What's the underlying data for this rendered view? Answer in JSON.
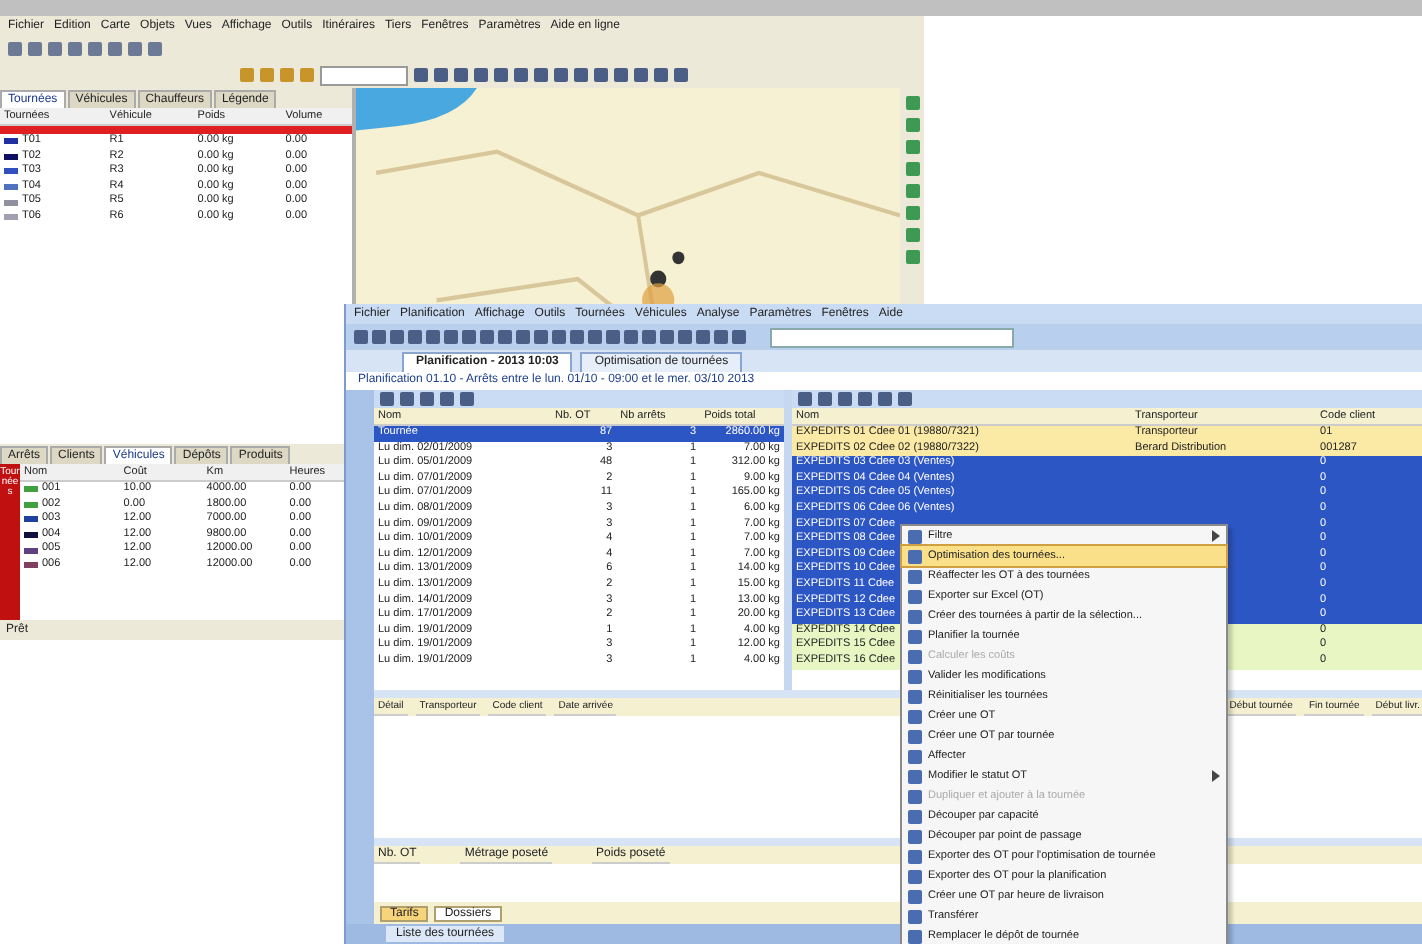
{
  "back_window": {
    "menu": [
      "Fichier",
      "Edition",
      "Carte",
      "Objets",
      "Vues",
      "Affichage",
      "Outils",
      "Itinéraires",
      "Tiers",
      "Fenêtres",
      "Paramètres",
      "Aide en ligne"
    ],
    "left_tabs": [
      {
        "label": "Tournées",
        "selected": true
      },
      {
        "label": "Véhicules",
        "selected": false
      },
      {
        "label": "Chauffeurs",
        "selected": false
      },
      {
        "label": "Légende",
        "selected": false
      }
    ],
    "routes_table": {
      "columns": [
        "Tournées",
        "Véhicule",
        "Poids",
        "Volume"
      ],
      "rows": [
        {
          "cells": [
            "T01",
            "R1",
            "0.00 kg",
            "0.00"
          ],
          "color": "#2030a0"
        },
        {
          "cells": [
            "T02",
            "R2",
            "0.00 kg",
            "0.00"
          ],
          "color": "#101060"
        },
        {
          "cells": [
            "T03",
            "R3",
            "0.00 kg",
            "0.00"
          ],
          "color": "#3050c0"
        },
        {
          "cells": [
            "T04",
            "R4",
            "0.00 kg",
            "0.00"
          ],
          "color": "#5070c0"
        },
        {
          "cells": [
            "T05",
            "R5",
            "0.00 kg",
            "0.00"
          ],
          "color": "#9090a0"
        },
        {
          "cells": [
            "T06",
            "R6",
            "0.00 kg",
            "0.00"
          ],
          "color": "#a0a0b0"
        }
      ]
    },
    "bottom_tabs": [
      {
        "label": "Arrêts",
        "selected": false
      },
      {
        "label": "Clients",
        "selected": false
      },
      {
        "label": "Véhicules",
        "selected": true
      },
      {
        "label": "Dépôts",
        "selected": false
      },
      {
        "label": "Produits",
        "selected": false
      }
    ],
    "side_label": "Tournées",
    "bottom_table": {
      "columns": [
        "Nom",
        "Coût",
        "Km",
        "Heures"
      ],
      "rows": [
        {
          "cells": [
            "001",
            "10.00",
            "4000.00",
            "0.00"
          ],
          "color": "#40a040"
        },
        {
          "cells": [
            "002",
            "0.00",
            "1800.00",
            "0.00"
          ],
          "color": "#40a040"
        },
        {
          "cells": [
            "003",
            "12.00",
            "7000.00",
            "0.00"
          ],
          "color": "#2040a0"
        },
        {
          "cells": [
            "004",
            "12.00",
            "9800.00",
            "0.00"
          ],
          "color": "#101040"
        },
        {
          "cells": [
            "005",
            "12.00",
            "12000.00",
            "0.00"
          ],
          "color": "#604080"
        },
        {
          "cells": [
            "006",
            "12.00",
            "12000.00",
            "0.00"
          ],
          "color": "#804060"
        }
      ]
    },
    "status": "Prêt"
  },
  "front_window": {
    "menu": [
      "Fichier",
      "Planification",
      "Affichage",
      "Outils",
      "Tournées",
      "Véhicules",
      "Analyse",
      "Paramètres",
      "Fenêtres",
      "Aide"
    ],
    "doc_tabs": [
      {
        "label": "Planification - 2013 10:03",
        "selected": true
      },
      {
        "label": "Optimisation de tournées",
        "selected": false
      }
    ],
    "info_line": "Planification 01.10 - Arrêts entre le lun. 01/10 - 09:00 et le mer. 03/10 2013",
    "tours_table": {
      "columns": [
        "Nom",
        "Nb. OT",
        "Nb arrêts",
        "Poids total"
      ],
      "rows": [
        {
          "cells": [
            "Tournée",
            "87",
            "3",
            "2860.00 kg"
          ],
          "selected": true
        },
        {
          "cells": [
            "Lu dim. 02/01/2009",
            "3",
            "1",
            "7.00 kg"
          ],
          "selected": false
        },
        {
          "cells": [
            "Lu dim. 05/01/2009",
            "48",
            "1",
            "312.00 kg"
          ],
          "selected": false
        },
        {
          "cells": [
            "Lu dim. 07/01/2009",
            "2",
            "1",
            "9.00 kg"
          ],
          "selected": false
        },
        {
          "cells": [
            "Lu dim. 07/01/2009",
            "11",
            "1",
            "165.00 kg"
          ],
          "selected": false
        },
        {
          "cells": [
            "Lu dim. 08/01/2009",
            "3",
            "1",
            "6.00 kg"
          ],
          "selected": false
        },
        {
          "cells": [
            "Lu dim. 09/01/2009",
            "3",
            "1",
            "7.00 kg"
          ],
          "selected": false
        },
        {
          "cells": [
            "Lu dim. 10/01/2009",
            "4",
            "1",
            "7.00 kg"
          ],
          "selected": false
        },
        {
          "cells": [
            "Lu dim. 12/01/2009",
            "4",
            "1",
            "7.00 kg"
          ],
          "selected": false
        },
        {
          "cells": [
            "Lu dim. 13/01/2009",
            "6",
            "1",
            "14.00 kg"
          ],
          "selected": false
        },
        {
          "cells": [
            "Lu dim. 13/01/2009",
            "2",
            "1",
            "15.00 kg"
          ],
          "selected": false
        },
        {
          "cells": [
            "Lu dim. 14/01/2009",
            "3",
            "1",
            "13.00 kg"
          ],
          "selected": false
        },
        {
          "cells": [
            "Lu dim. 17/01/2009",
            "2",
            "1",
            "20.00 kg"
          ],
          "selected": false
        },
        {
          "cells": [
            "Lu dim. 19/01/2009",
            "1",
            "1",
            "4.00 kg"
          ],
          "selected": false
        },
        {
          "cells": [
            "Lu dim. 19/01/2009",
            "3",
            "1",
            "12.00 kg"
          ],
          "selected": false
        },
        {
          "cells": [
            "Lu dim. 19/01/2009",
            "3",
            "1",
            "4.00 kg"
          ],
          "selected": false
        }
      ]
    },
    "orders_table": {
      "columns": [
        "Nom",
        "Transporteur",
        "Code client"
      ],
      "rows": [
        {
          "kind": "group",
          "cells": [
            "EXPEDITS 01 Cdee 01 (19880/7321)",
            "Transporteur",
            "01"
          ],
          "selected": false
        },
        {
          "kind": "group",
          "cells": [
            "EXPEDITS 02 Cdee 02 (19880/7322)",
            "Berard Distribution",
            "001287"
          ],
          "selected": false
        },
        {
          "kind": "item",
          "cells": [
            "EXPEDITS 03 Cdee 03 (Ventes)",
            "",
            "0"
          ],
          "selected": true
        },
        {
          "kind": "item",
          "cells": [
            "EXPEDITS 04 Cdee 04 (Ventes)",
            "",
            "0"
          ],
          "selected": true
        },
        {
          "kind": "item",
          "cells": [
            "EXPEDITS 05 Cdee 05 (Ventes)",
            "",
            "0"
          ],
          "selected": true
        },
        {
          "kind": "item",
          "cells": [
            "EXPEDITS 06 Cdee 06 (Ventes)",
            "",
            "0"
          ],
          "selected": true
        },
        {
          "kind": "item",
          "cells": [
            "EXPEDITS 07 Cdee",
            "",
            "0"
          ],
          "selected": true
        },
        {
          "kind": "item",
          "cells": [
            "EXPEDITS 08 Cdee",
            "",
            "0"
          ],
          "selected": true
        },
        {
          "kind": "item",
          "cells": [
            "EXPEDITS 09 Cdee",
            "",
            "0"
          ],
          "selected": true
        },
        {
          "kind": "item",
          "cells": [
            "EXPEDITS 10 Cdee",
            "",
            "0"
          ],
          "selected": true
        },
        {
          "kind": "item",
          "cells": [
            "EXPEDITS 11 Cdee",
            "",
            "0"
          ],
          "selected": true
        },
        {
          "kind": "item",
          "cells": [
            "EXPEDITS 12 Cdee",
            "",
            "0"
          ],
          "selected": true
        },
        {
          "kind": "item",
          "cells": [
            "EXPEDITS 13 Cdee",
            "",
            "0"
          ],
          "selected": true
        },
        {
          "kind": "item",
          "cells": [
            "EXPEDITS 14 Cdee",
            "",
            "0"
          ],
          "selected": false
        },
        {
          "kind": "item",
          "cells": [
            "EXPEDITS 15 Cdee",
            "",
            "0"
          ],
          "selected": false
        },
        {
          "kind": "item",
          "cells": [
            "EXPEDITS 16 Cdee",
            "",
            "0"
          ],
          "selected": false
        }
      ]
    },
    "detail_columns": [
      "Détail",
      "Transporteur",
      "Code client",
      "Date arrivée",
      "Début tournée",
      "Fin tournée",
      "Début livr."
    ],
    "summary_columns": [
      "Nb. OT",
      "Métrage poseté",
      "Poids poseté"
    ],
    "bottom_tabs": [
      {
        "label": "Tarifs",
        "selected": true
      },
      {
        "label": "Dossiers",
        "selected": false
      }
    ],
    "footer_tab": "Liste des tournées"
  },
  "context_menu": [
    {
      "label": "Filtre",
      "selected": false,
      "disabled": false,
      "submenu": true
    },
    {
      "label": "Optimisation des tournées...",
      "selected": true,
      "disabled": false,
      "submenu": false
    },
    {
      "label": "Réaffecter les OT à des tournées",
      "selected": false,
      "disabled": false,
      "submenu": false
    },
    {
      "label": "Exporter sur Excel (OT)",
      "selected": false,
      "disabled": false,
      "submenu": false
    },
    {
      "label": "Créer des tournées à partir de la sélection...",
      "selected": false,
      "disabled": false,
      "submenu": false
    },
    {
      "label": "Planifier la tournée",
      "selected": false,
      "disabled": false,
      "submenu": false
    },
    {
      "label": "Calculer les coûts",
      "selected": false,
      "disabled": true,
      "submenu": false
    },
    {
      "label": "Valider les modifications",
      "selected": false,
      "disabled": false,
      "submenu": false
    },
    {
      "label": "Réinitialiser les tournées",
      "selected": false,
      "disabled": false,
      "submenu": false
    },
    {
      "label": "Créer une OT",
      "selected": false,
      "disabled": false,
      "submenu": false
    },
    {
      "label": "Créer une OT par tournée",
      "selected": false,
      "disabled": false,
      "submenu": false
    },
    {
      "label": "Affecter",
      "selected": false,
      "disabled": false,
      "submenu": false
    },
    {
      "label": "Modifier le statut OT",
      "selected": false,
      "disabled": false,
      "submenu": true
    },
    {
      "label": "Dupliquer et ajouter à la tournée",
      "selected": false,
      "disabled": true,
      "submenu": false
    },
    {
      "label": "Découper par capacité",
      "selected": false,
      "disabled": false,
      "submenu": false
    },
    {
      "label": "Découper par point de passage",
      "selected": false,
      "disabled": false,
      "submenu": false
    },
    {
      "label": "Exporter des OT pour l'optimisation de tournée",
      "selected": false,
      "disabled": false,
      "submenu": false
    },
    {
      "label": "Exporter des OT pour la planification",
      "selected": false,
      "disabled": false,
      "submenu": false
    },
    {
      "label": "Créer une OT par heure de livraison",
      "selected": false,
      "disabled": false,
      "submenu": false
    },
    {
      "label": "Transférer",
      "selected": false,
      "disabled": false,
      "submenu": false
    },
    {
      "label": "Remplacer le dépôt de tournée",
      "selected": false,
      "disabled": false,
      "submenu": false
    }
  ]
}
